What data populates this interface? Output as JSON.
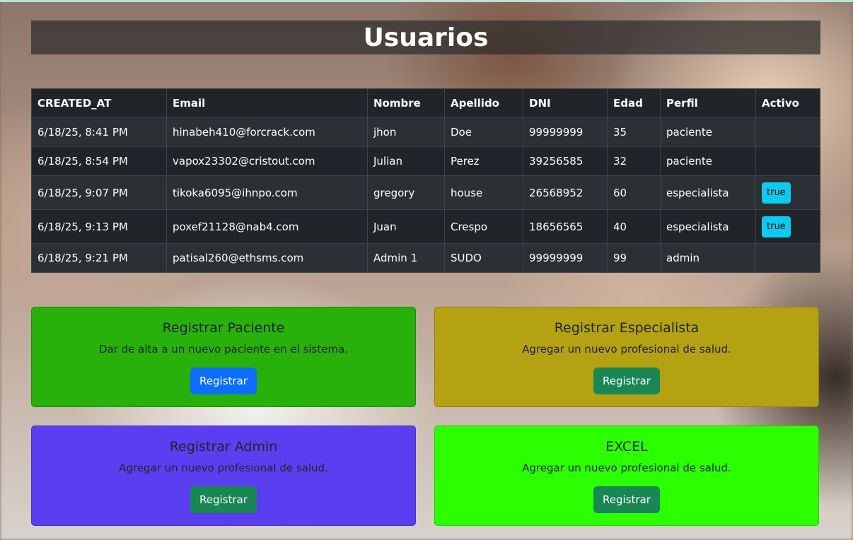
{
  "page": {
    "title": "Usuarios"
  },
  "table": {
    "headers": [
      "CREATED_AT",
      "Email",
      "Nombre",
      "Apellido",
      "DNI",
      "Edad",
      "Perfil",
      "Activo"
    ],
    "rows": [
      {
        "created_at": "6/18/25, 8:41 PM",
        "email": "hinabeh410@forcrack.com",
        "nombre": "jhon",
        "apellido": "Doe",
        "dni": "99999999",
        "edad": "35",
        "perfil": "paciente",
        "activo": ""
      },
      {
        "created_at": "6/18/25, 8:54 PM",
        "email": "vapox23302@cristout.com",
        "nombre": "Julian",
        "apellido": "Perez",
        "dni": "39256585",
        "edad": "32",
        "perfil": "paciente",
        "activo": ""
      },
      {
        "created_at": "6/18/25, 9:07 PM",
        "email": "tikoka6095@ihnpo.com",
        "nombre": "gregory",
        "apellido": "house",
        "dni": "26568952",
        "edad": "60",
        "perfil": "especialista",
        "activo": "true"
      },
      {
        "created_at": "6/18/25, 9:13 PM",
        "email": "poxef21128@nab4.com",
        "nombre": "Juan",
        "apellido": "Crespo",
        "dni": "18656565",
        "edad": "40",
        "perfil": "especialista",
        "activo": "true"
      },
      {
        "created_at": "6/18/25, 9:21 PM",
        "email": "patisal260@ethsms.com",
        "nombre": "Admin 1",
        "apellido": "SUDO",
        "dni": "99999999",
        "edad": "99",
        "perfil": "admin",
        "activo": ""
      }
    ]
  },
  "cards": [
    {
      "title": "Registrar Paciente",
      "text": "Dar de alta a un nuevo paciente en el sistema.",
      "button": "Registrar",
      "color": "#27b10a",
      "button_color": "#0d6efd"
    },
    {
      "title": "Registrar Especialista",
      "text": "Agregar un nuevo profesional de salud.",
      "button": "Registrar",
      "color": "#b4a213",
      "button_color": "#198754"
    },
    {
      "title": "Registrar Admin",
      "text": "Agregar un nuevo profesional de salud.",
      "button": "Registrar",
      "color": "#5b3ef0",
      "button_color": "#198754"
    },
    {
      "title": "EXCEL",
      "text": "Agregar un nuevo profesional de salud.",
      "button": "Registrar",
      "color": "#2bff00",
      "button_color": "#198754"
    }
  ]
}
